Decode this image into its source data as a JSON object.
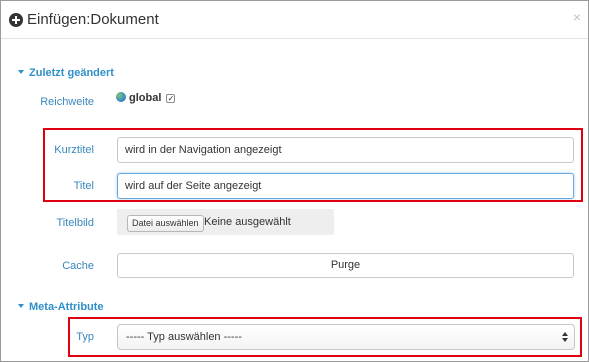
{
  "dialog": {
    "title": "Einfügen:Dokument"
  },
  "section_recent": {
    "heading": "Zuletzt geändert",
    "reach_label": "Reichweite",
    "reach_value": "global"
  },
  "fields": {
    "short_title_label": "Kurztitel",
    "short_title_value": "wird in der Navigation angezeigt",
    "title_label": "Titel",
    "title_value": "wird auf der Seite angezeigt",
    "title_image_label": "Titelbild",
    "file_button_label": "Datei auswählen",
    "file_status": "Keine ausgewählt",
    "cache_label": "Cache",
    "purge_label": "Purge"
  },
  "section_meta": {
    "heading": "Meta-Attribute",
    "type_label": "Typ",
    "type_selected": "----- Typ auswählen -----"
  },
  "colors": {
    "accent": "#2f8fc8",
    "highlight": "#e0000f"
  }
}
